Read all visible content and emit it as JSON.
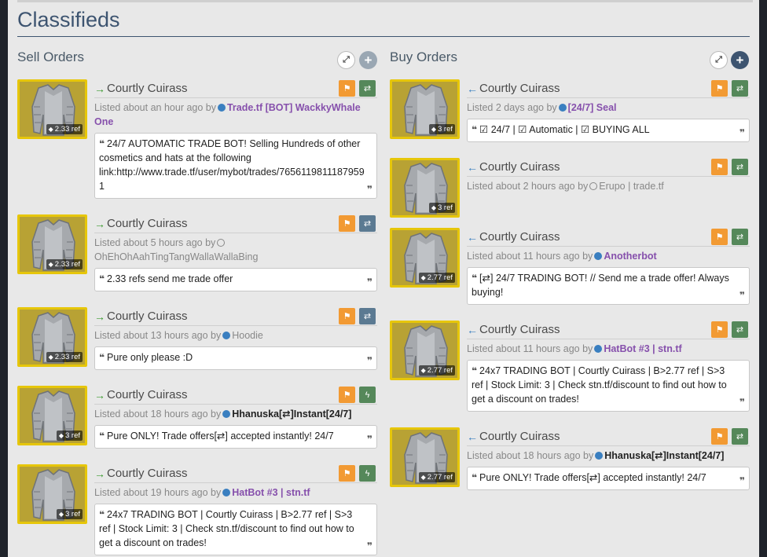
{
  "page": {
    "title": "Classifieds"
  },
  "colors": {
    "accent": "#3d5470",
    "flag": "#f29a33",
    "trade": "#55885a",
    "trade_alt": "#5b7a92",
    "user_bot": "#8650ac",
    "online_dot": "#3a7fc0",
    "sell_arrow": "#3a9a2e",
    "buy_arrow": "#3a7fc0"
  },
  "sell": {
    "header": "Sell Orders",
    "listings": [
      {
        "item": "Courtly Cuirass",
        "price": "2.33 ref",
        "meta": "Listed about an hour ago by",
        "user": "Trade.tf [BOT] WackkyWhale One",
        "comment": "24/7 AUTOMATIC TRADE BOT! Selling Hundreds of other cosmetics and hats at the following link:http://www.trade.tf/user/mybot/trades/7656119811187959 1"
      },
      {
        "item": "Courtly Cuirass",
        "price": "2.33 ref",
        "meta": "Listed about 5 hours ago by",
        "user": "OhEhOhAahTingTangWallaWallaBing",
        "comment": "2.33 refs send me trade offer"
      },
      {
        "item": "Courtly Cuirass",
        "price": "2.33 ref",
        "meta": "Listed about 13 hours ago by",
        "user": "Hoodie",
        "comment": "Pure only please :D"
      },
      {
        "item": "Courtly Cuirass",
        "price": "3 ref",
        "meta": "Listed about 18 hours ago by",
        "user": "Hhanuska[⇄]Instant[24/7]",
        "comment": "Pure ONLY! Trade offers[⇄] accepted instantly! 24/7"
      },
      {
        "item": "Courtly Cuirass",
        "price": "3 ref",
        "meta": "Listed about 19 hours ago by",
        "user": "HatBot #3 | stn.tf",
        "comment": "24x7 TRADING BOT | Courtly Cuirass | B>2.77 ref | S>3 ref | Stock Limit: 3 | Check stn.tf/discount to find out how to get a discount on trades!"
      }
    ]
  },
  "buy": {
    "header": "Buy Orders",
    "listings": [
      {
        "item": "Courtly Cuirass",
        "price": "3 ref",
        "meta": "Listed 2 days ago by",
        "user": "[24/7] Seal",
        "comment": "☑ 24/7 | ☑ Automatic | ☑ BUYING ALL"
      },
      {
        "item": "Courtly Cuirass",
        "price": "3 ref",
        "meta": "Listed about 2 hours ago by",
        "user": "Erupo | trade.tf",
        "comment": ""
      },
      {
        "item": "Courtly Cuirass",
        "price": "2.77 ref",
        "meta": "Listed about 11 hours ago by",
        "user": "Anotherbot",
        "comment": "[⇄] 24/7 TRADING BOT! // Send me a trade offer! Always buying!"
      },
      {
        "item": "Courtly Cuirass",
        "price": "2.77 ref",
        "meta": "Listed about 11 hours ago by",
        "user": "HatBot #3 | stn.tf",
        "comment": "24x7 TRADING BOT | Courtly Cuirass | B>2.77 ref | S>3 ref | Stock Limit: 3 | Check stn.tf/discount to find out how to get a discount on trades!"
      },
      {
        "item": "Courtly Cuirass",
        "price": "2.77 ref",
        "meta": "Listed about 18 hours ago by",
        "user": "Hhanuska[⇄]Instant[24/7]",
        "comment": "Pure ONLY! Trade offers[⇄] accepted instantly! 24/7"
      }
    ]
  },
  "icons": {
    "arrow_sell": "→",
    "arrow_buy": "←",
    "expand": "⤢",
    "add": "+",
    "flag": "⚑",
    "trade": "⇄",
    "lightning": "ϟ",
    "tag": "🏷",
    "quote_open": "❝",
    "quote_close": "❞"
  }
}
